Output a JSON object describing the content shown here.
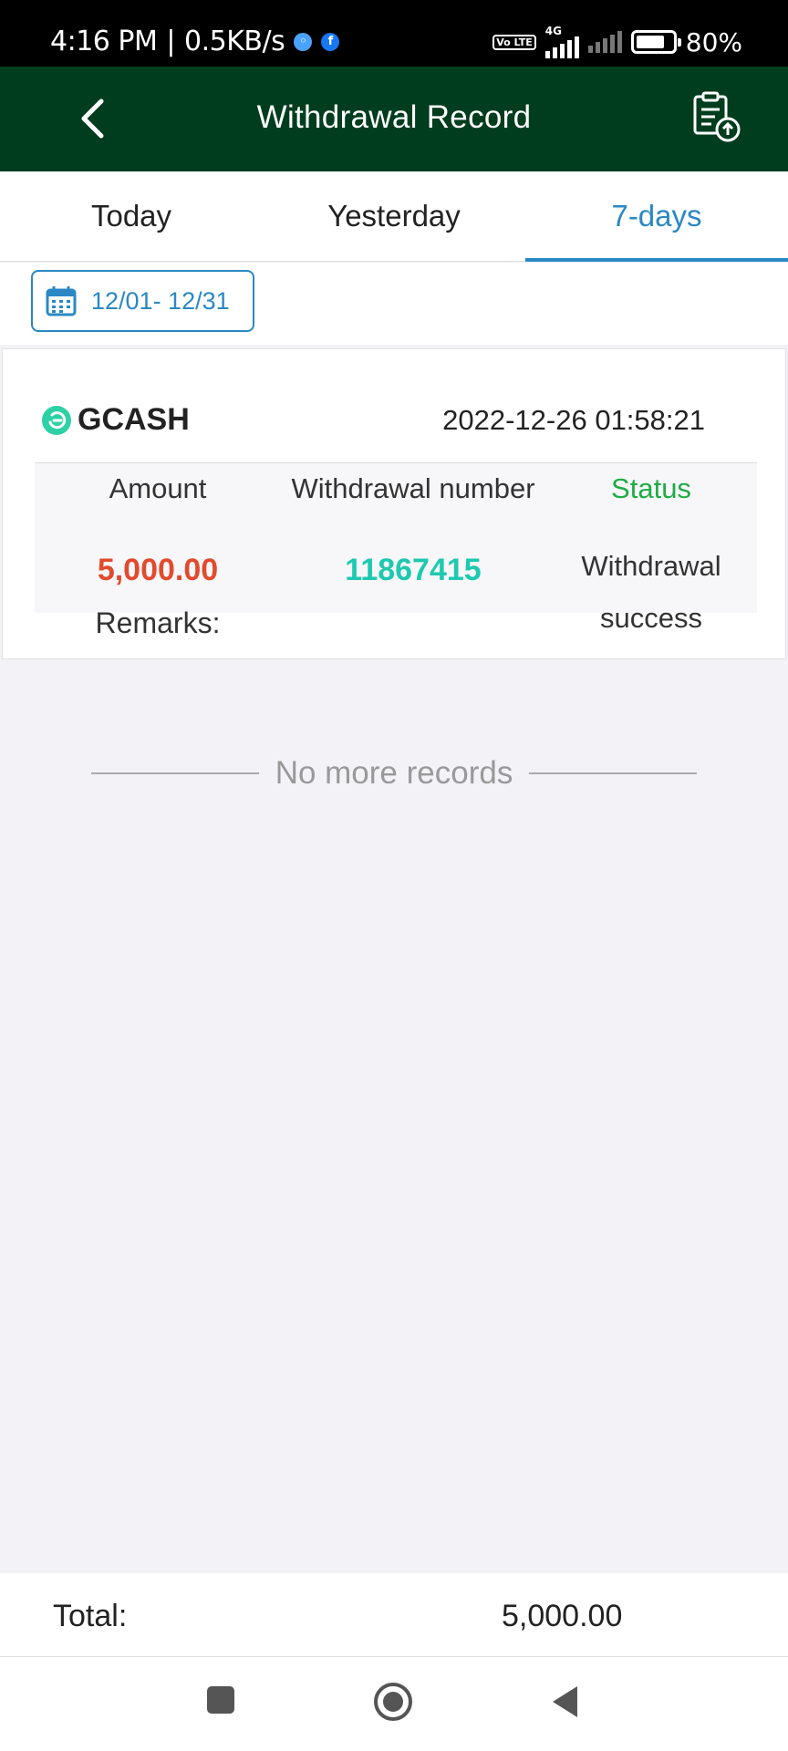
{
  "status_bar": {
    "time": "4:16 PM",
    "speed": "0.5KB/s",
    "network": "4G",
    "volte": "Vo LTE",
    "battery": "80%",
    "battery_level": 0.8
  },
  "header": {
    "title": "Withdrawal Record",
    "back_icon": "chevron-left-icon",
    "action_icon": "clipboard-upload-icon"
  },
  "tabs": [
    {
      "label": "Today",
      "active": false
    },
    {
      "label": "Yesterday",
      "active": false
    },
    {
      "label": "7-days",
      "active": true
    }
  ],
  "filter": {
    "date_range": "12/01- 12/31",
    "icon": "calendar-icon"
  },
  "records": [
    {
      "provider": "GCASH",
      "datetime": "2022-12-26 01:58:21",
      "amount_label": "Amount",
      "number_label": "Withdrawal number",
      "status_label": "Status",
      "amount": "5,000.00",
      "withdrawal_number": "11867415",
      "status_line1": "Withdrawal",
      "status_line2": "success",
      "remarks_label": "Remarks:"
    }
  ],
  "no_more": "No more records",
  "total": {
    "label": "Total:",
    "value": "5,000.00"
  },
  "colors": {
    "header_bg": "#003d1e",
    "accent": "#2a88c4",
    "amount": "#e24a2e",
    "number": "#1ec9b0",
    "status_header": "#1fac46"
  }
}
